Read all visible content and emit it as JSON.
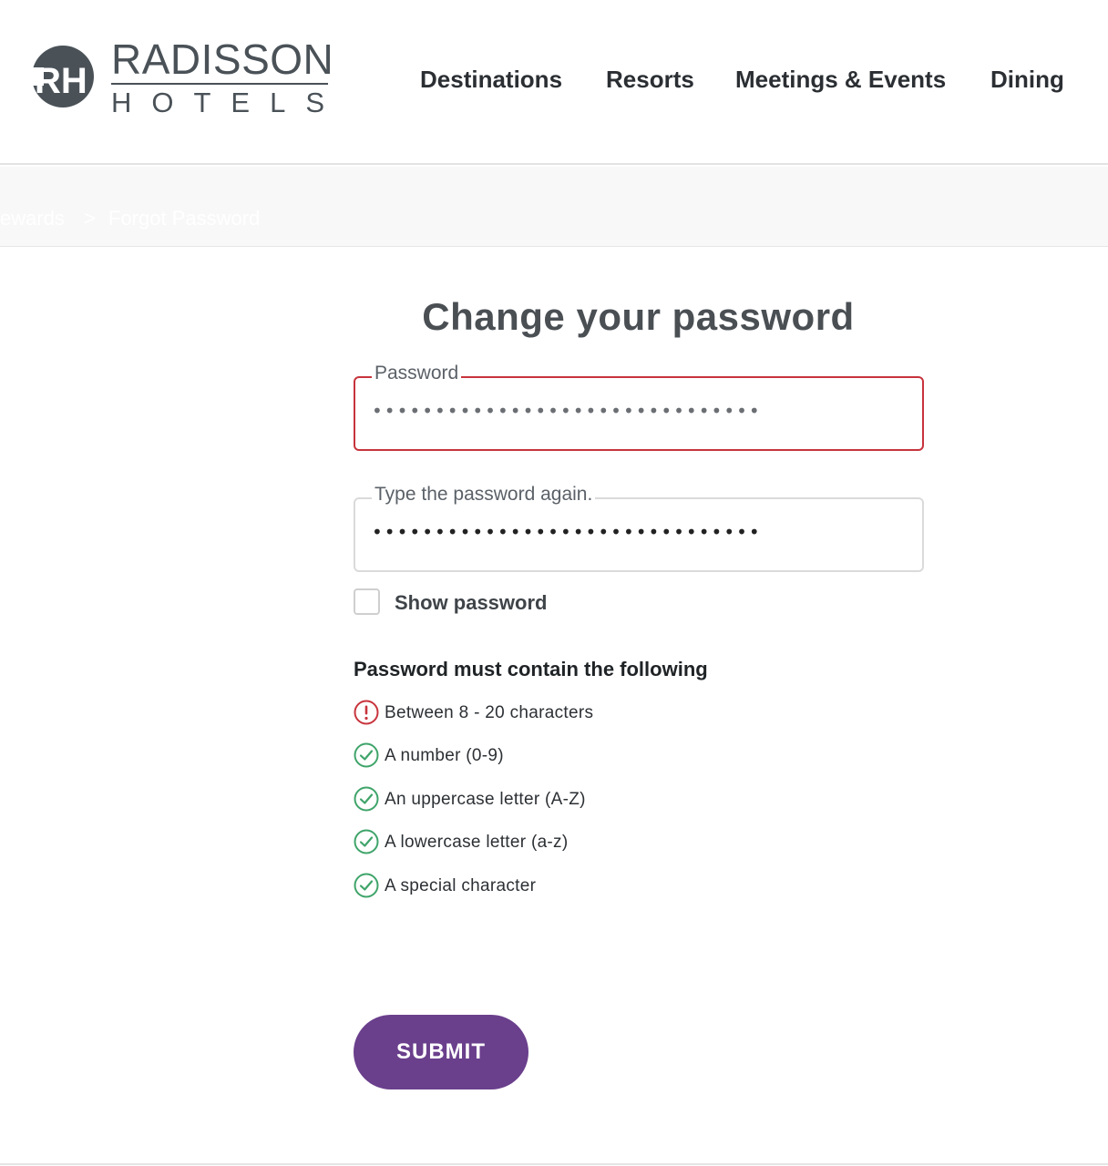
{
  "brand": {
    "name": "RADISSON",
    "sub": "HOTELS",
    "colors": {
      "primary": "#4a5258",
      "accent": "#6a3f8c",
      "error": "#c8343d",
      "success": "#3fa46a"
    }
  },
  "nav": {
    "items": [
      {
        "label": "Destinations"
      },
      {
        "label": "Resorts"
      },
      {
        "label": "Meetings & Events"
      },
      {
        "label": "Dining"
      }
    ]
  },
  "breadcrumb": {
    "items": [
      {
        "label": "ewards"
      },
      {
        "label": "Forgot Password"
      }
    ],
    "separator": ">"
  },
  "form": {
    "title": "Change your password",
    "password": {
      "label": "Password",
      "value": "•••••••••••••••••••••••••••••••"
    },
    "confirm": {
      "label": "Type the password again.",
      "value": "•••••••••••••••••••••••••••••••"
    },
    "show_password_label": "Show password",
    "show_password_checked": false,
    "requirements_title": "Password must contain the following",
    "requirements": [
      {
        "text": "Between 8 - 20 characters",
        "status": "error",
        "icon": "exclamation-circle-icon"
      },
      {
        "text": "A number (0-9)",
        "status": "ok",
        "icon": "check-circle-icon"
      },
      {
        "text": "An uppercase letter (A-Z)",
        "status": "ok",
        "icon": "check-circle-icon"
      },
      {
        "text": "A lowercase letter (a-z)",
        "status": "ok",
        "icon": "check-circle-icon"
      },
      {
        "text": "A special character",
        "status": "ok",
        "icon": "check-circle-icon"
      }
    ],
    "submit_label": "SUBMIT"
  }
}
